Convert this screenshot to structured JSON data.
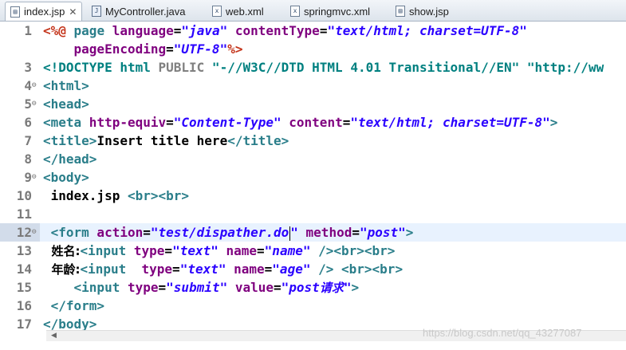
{
  "tabs": [
    {
      "label": "index.jsp",
      "icon": "jsp-file-icon",
      "active": true
    },
    {
      "label": "MyController.java",
      "icon": "java-file-icon"
    },
    {
      "label": "web.xml",
      "icon": "xml-file-icon"
    },
    {
      "label": "springmvc.xml",
      "icon": "xml-file-icon"
    },
    {
      "label": "show.jsp",
      "icon": "jsp-file-icon"
    }
  ],
  "tab_close_glyph": "✕",
  "lines": [
    {
      "num": "1"
    },
    {
      "num": ""
    },
    {
      "num": "3"
    },
    {
      "num": "4"
    },
    {
      "num": "5"
    },
    {
      "num": "6"
    },
    {
      "num": "7"
    },
    {
      "num": "8"
    },
    {
      "num": "9"
    },
    {
      "num": "10"
    },
    {
      "num": "11"
    },
    {
      "num": "12"
    },
    {
      "num": "13"
    },
    {
      "num": "14"
    },
    {
      "num": "15"
    },
    {
      "num": "16"
    },
    {
      "num": "17"
    }
  ],
  "code": {
    "l1": {
      "open": "<%@",
      "page": " page",
      "lang_attr": " language",
      "eq": "=",
      "lang_val": "\"java\"",
      "ct_attr": " contentType",
      "ct_val": "\"text/html; charset=UTF-8\""
    },
    "l2": {
      "indent": "    ",
      "pe_attr": "pageEncoding",
      "pe_val": "\"UTF-8\"",
      "close": "%>"
    },
    "l3": {
      "doctype": "<!DOCTYPE html",
      "public": " PUBLIC",
      "rest": " \"-//W3C//DTD HTML 4.01 Transitional//EN\" \"http://ww"
    },
    "l4": {
      "tag": "<html>"
    },
    "l5": {
      "tag": "<head>"
    },
    "l6": {
      "open": "<meta",
      "a1": " http-equiv",
      "v1": "\"Content-Type\"",
      "a2": " content",
      "v2": "\"text/html; charset=UTF-8\"",
      "close": ">"
    },
    "l7": {
      "open": "<title>",
      "text": "Insert title here",
      "close": "</title>"
    },
    "l8": {
      "tag": "</head>"
    },
    "l9": {
      "tag": "<body>"
    },
    "l10": {
      "text": " index.jsp ",
      "br": "<br><br>"
    },
    "l12": {
      "open": " <form",
      "a1": " action",
      "v1a": "\"test/dispather.do",
      "v1b": "\"",
      "a2": " method",
      "v2": "\"post\"",
      "close": ">"
    },
    "l13": {
      "label": "  姓名:",
      "open": "<input",
      "a1": " type",
      "v1": "\"text\"",
      "a2": " name",
      "v2": "\"name\"",
      "close": " />",
      "br": "<br><br>"
    },
    "l14": {
      "label": "  年龄:",
      "open": "<input",
      "a1": "  type",
      "v1": "\"text\"",
      "a2": " name",
      "v2": "\"age\"",
      "close": " />",
      "br": " <br><br>"
    },
    "l15": {
      "indent": "    ",
      "open": "<input",
      "a1": " type",
      "v1": "\"submit\"",
      "a2": " value",
      "v2a": "\"post",
      "v2cn": "请求",
      "v2b": "\"",
      "close": ">"
    },
    "l16": {
      "tag": " </form>"
    },
    "l17": {
      "tag": "</body>"
    }
  },
  "watermark": "https://blog.csdn.net/qq_43277087",
  "colors": {
    "tag": "#2a7e8a",
    "attribute": "#7f007f",
    "value": "#2a00ff",
    "jsp_directive": "#c4341a",
    "current_line": "#e8f2fe"
  }
}
